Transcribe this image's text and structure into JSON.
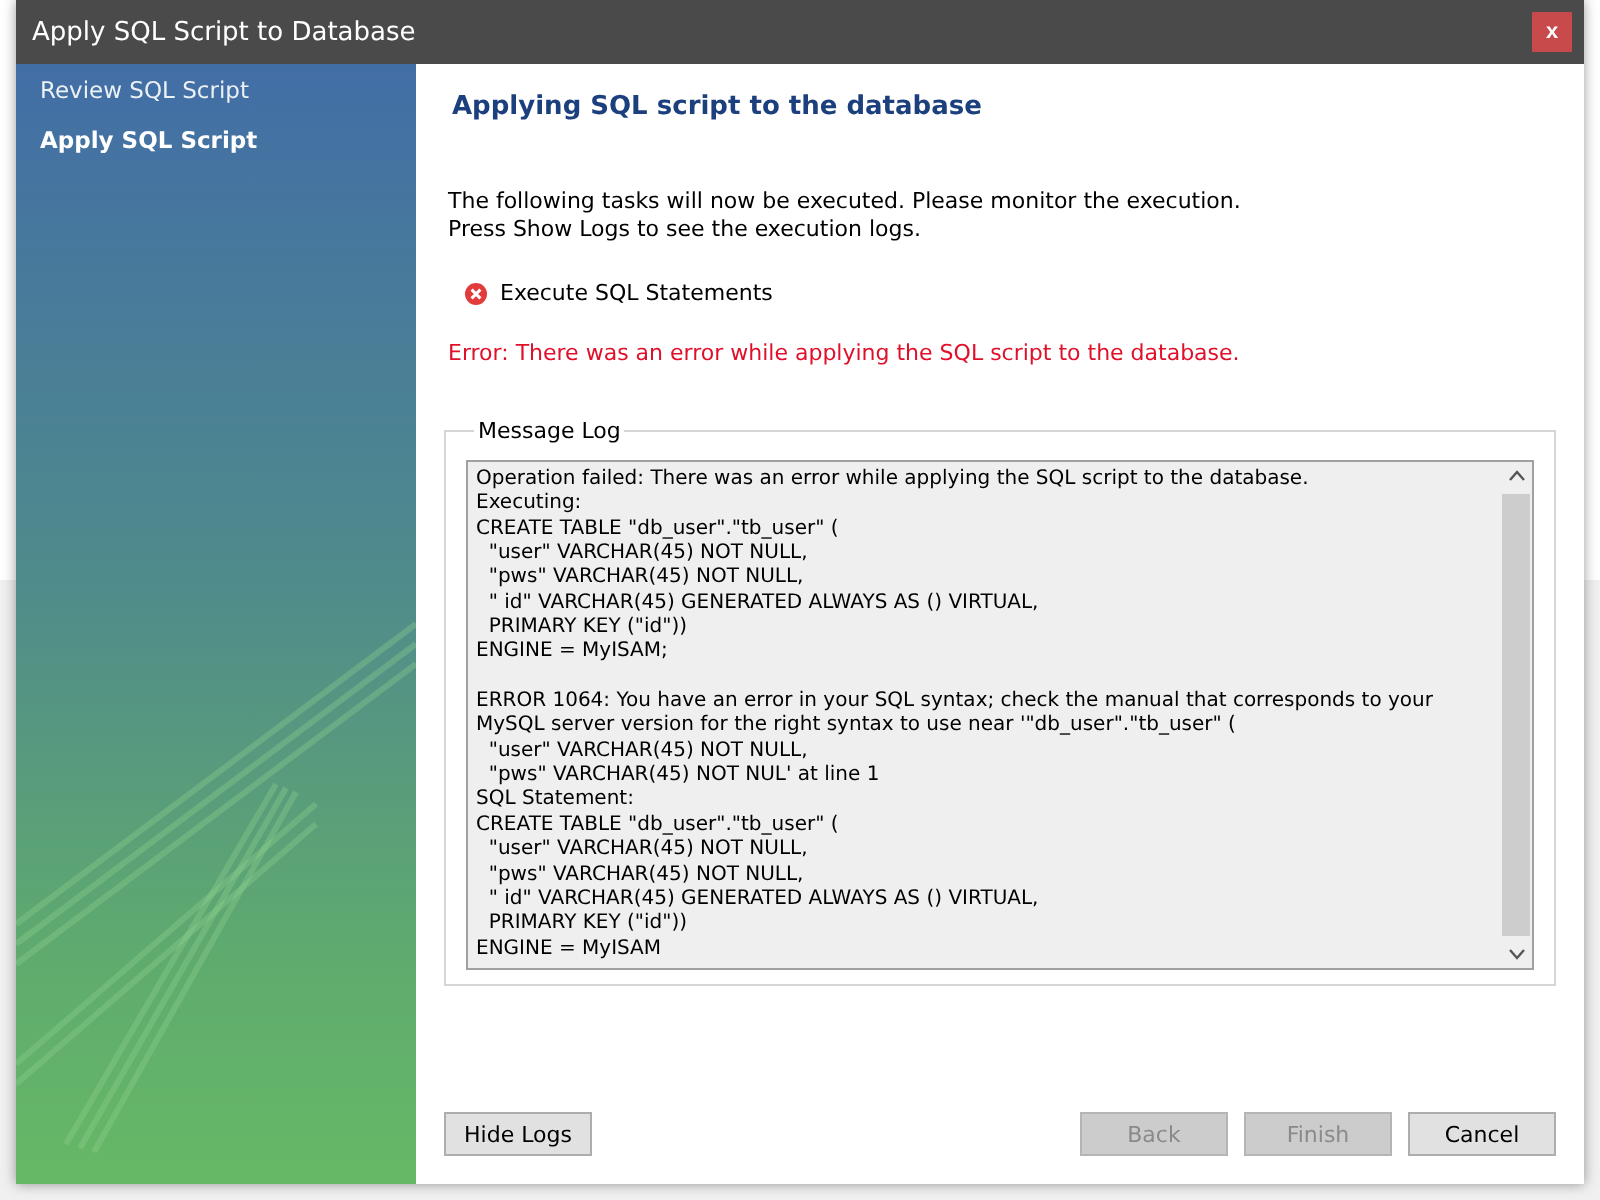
{
  "window": {
    "title": "Apply SQL Script to Database",
    "close_label": "x"
  },
  "sidebar": {
    "items": [
      {
        "label": "Review SQL Script",
        "selected": false
      },
      {
        "label": "Apply SQL Script",
        "selected": true
      }
    ]
  },
  "heading": "Applying SQL script to the database",
  "intro": [
    "The following tasks will now be executed. Please monitor the execution.",
    "Press Show Logs to see the execution logs."
  ],
  "tasks": [
    {
      "label": "Execute SQL Statements",
      "failed": true
    }
  ],
  "error": "Error: There was an error while applying the SQL script to the database.",
  "message_log": {
    "title": "Message Log",
    "paragraphs": [
      [
        "Operation failed: There was an error while applying the SQL script to the database.",
        "Executing:",
        "CREATE TABLE \"db_user\".\"tb_user\" (",
        "  \"user\" VARCHAR(45) NOT NULL,",
        "  \"pws\" VARCHAR(45) NOT NULL,",
        "  \" id\" VARCHAR(45) GENERATED ALWAYS AS () VIRTUAL,",
        "  PRIMARY KEY (\"id\"))",
        "ENGINE = MyISAM;"
      ],
      [
        "ERROR 1064: You have an error in your SQL syntax; check the manual that corresponds to your MySQL server version for the right syntax to use near '\"db_user\".\"tb_user\" (",
        "  \"user\" VARCHAR(45) NOT NULL,",
        "  \"pws\" VARCHAR(45) NOT NUL' at line 1",
        "SQL Statement:",
        "CREATE TABLE \"db_user\".\"tb_user\" (",
        "  \"user\" VARCHAR(45) NOT NULL,",
        "  \"pws\" VARCHAR(45) NOT NULL,",
        "  \" id\" VARCHAR(45) GENERATED ALWAYS AS () VIRTUAL,",
        "  PRIMARY KEY (\"id\"))",
        "ENGINE = MyISAM"
      ]
    ]
  },
  "left_buttons": [
    {
      "label": "Hide Logs",
      "disabled": false
    }
  ],
  "right_buttons": [
    {
      "label": "Back",
      "disabled": true
    },
    {
      "label": "Finish",
      "disabled": true
    },
    {
      "label": "Cancel",
      "disabled": false
    }
  ]
}
